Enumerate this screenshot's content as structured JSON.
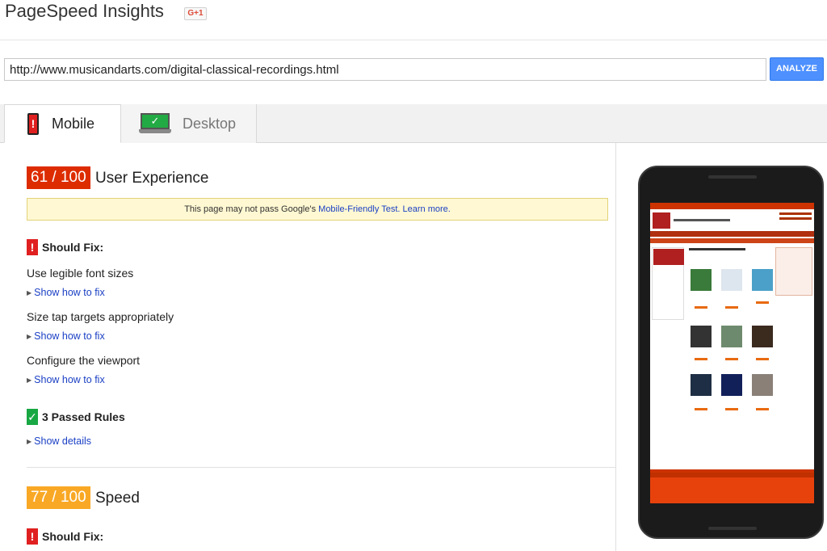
{
  "app": {
    "title": "PageSpeed Insights",
    "gplus": "G+1"
  },
  "url_bar": {
    "value": "http://www.musicandarts.com/digital-classical-recordings.html",
    "analyze": "ANALYZE"
  },
  "tabs": [
    {
      "label": "Mobile",
      "icon": "mobile-phone-icon"
    },
    {
      "label": "Desktop",
      "icon": "desktop-monitor-icon"
    }
  ],
  "ux": {
    "score": "61 / 100",
    "label": "User Experience",
    "notice_prefix": "This page may not pass Google's ",
    "notice_link": "Mobile-Friendly Test.",
    "notice_learn": "Learn more.",
    "should_fix": "Should Fix:",
    "rules": [
      {
        "title": "Use legible font sizes",
        "action": "Show how to fix"
      },
      {
        "title": "Size tap targets appropriately",
        "action": "Show how to fix"
      },
      {
        "title": "Configure the viewport",
        "action": "Show how to fix"
      }
    ],
    "passed": "3 Passed Rules",
    "passed_action": "Show details"
  },
  "speed": {
    "score": "77 / 100",
    "label": "Speed",
    "should_fix": "Should Fix:"
  },
  "colors": {
    "fail": "#dd2c00",
    "warn": "#f9a825",
    "pass": "#18a843",
    "link": "#1a3fc4",
    "accent": "#4d90fe"
  }
}
